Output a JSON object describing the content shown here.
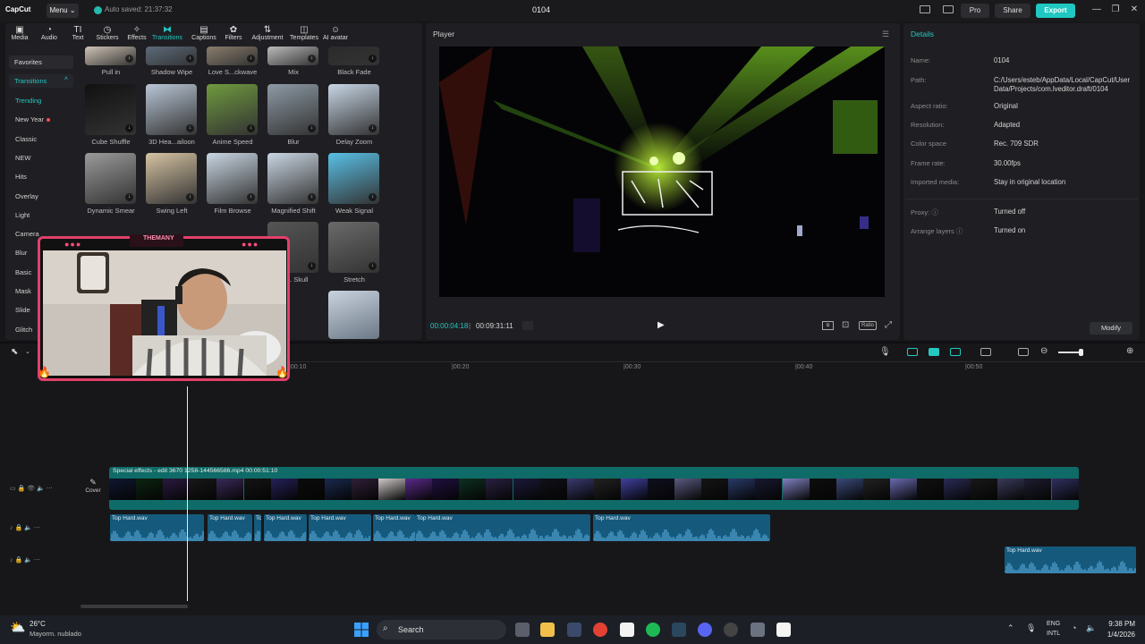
{
  "app": {
    "logo": "CapCut",
    "menu_label": "Menu",
    "autosave_text": "Auto saved: 21:37:32",
    "project_title": "0104",
    "pro_label": "Pro",
    "share_label": "Share",
    "export_label": "Export",
    "window_controls": [
      "—",
      "❐",
      "✕"
    ]
  },
  "toolbar": [
    {
      "label": "Media",
      "icon": "▣"
    },
    {
      "label": "Audio",
      "icon": "◔"
    },
    {
      "label": "Text",
      "icon": "TI"
    },
    {
      "label": "Stickers",
      "icon": "◷"
    },
    {
      "label": "Effects",
      "icon": "✧"
    },
    {
      "label": "Transitions",
      "icon": "⧓"
    },
    {
      "label": "Captions",
      "icon": "▤"
    },
    {
      "label": "Filters",
      "icon": "✿"
    },
    {
      "label": "Adjustment",
      "icon": "⇅"
    },
    {
      "label": "Templates",
      "icon": "◫"
    },
    {
      "label": "AI avatar",
      "icon": "☺"
    }
  ],
  "categories": {
    "favorites": "Favorites",
    "transitions": "Transitions",
    "items": [
      "Trending",
      "New Year",
      "Classic",
      "NEW",
      "Hits",
      "Overlay",
      "Light",
      "Camera",
      "Blur",
      "Basic",
      "Mask",
      "Slide",
      "Glitch"
    ]
  },
  "transitions_row0": [
    "Pull in",
    "Shadow Wipe",
    "Love S...ckwave",
    "Mix",
    "Black Fade"
  ],
  "transitions_row1": [
    "Cube Shuffle",
    "3D Hea...ailoon",
    "Anime Speed",
    "Blur",
    "Delay Zoom"
  ],
  "transitions_row2": [
    "Dynamic Smear",
    "Swing Left",
    "Film Browse",
    "Magnified Shift",
    "Weak Signal"
  ],
  "transitions_row3": [
    "",
    "",
    "",
    "...r... Skull",
    "Stretch"
  ],
  "player": {
    "title": "Player",
    "current_time": "00:00:04:18",
    "total_time": "00:09:31:11",
    "ratio_label": "Ratio"
  },
  "details": {
    "title": "Details",
    "rows": [
      {
        "key": "Name:",
        "value": "0104"
      },
      {
        "key": "Path:",
        "value": "C:/Users/esteb/AppData/Local/CapCut/User Data/Projects/com.lveditor.draft/0104"
      },
      {
        "key": "Aspect ratio:",
        "value": "Original"
      },
      {
        "key": "Resolution:",
        "value": "Adapted"
      },
      {
        "key": "Color space",
        "value": "Rec. 709 SDR"
      },
      {
        "key": "Frame rate:",
        "value": "30.00fps"
      },
      {
        "key": "Imported media:",
        "value": "Stay in original location"
      },
      {
        "key": "Proxy: ⓘ",
        "value": "Turned off"
      },
      {
        "key": "Arrange layers ⓘ",
        "value": "Turned on"
      }
    ],
    "modify_label": "Modify"
  },
  "timeline": {
    "ruler": [
      "|00:10",
      "|00:20",
      "|00:30",
      "|00:40",
      "|00:50"
    ],
    "video_track_label": "Special effects - edit  3670  1258-144566586.mp4  00:00:51:10",
    "cover_label": "Cover",
    "audio_clips": [
      "Top Hard.wav",
      "Top Hard.wav",
      "Top",
      "Top Hard.wav",
      "Top Hard.wav",
      "Top Hard.wav",
      "Top Hard.wav",
      "Top Hard.wav",
      "Top Hard.wav"
    ]
  },
  "webcam": {
    "brand": "THEMANY"
  },
  "taskbar": {
    "temp": "26°C",
    "weather": "Mayorm. nublado",
    "search": "Search",
    "lang_top": "ENG",
    "lang_bottom": "INTL",
    "time": "9:38 PM",
    "date": "1/4/2026"
  }
}
